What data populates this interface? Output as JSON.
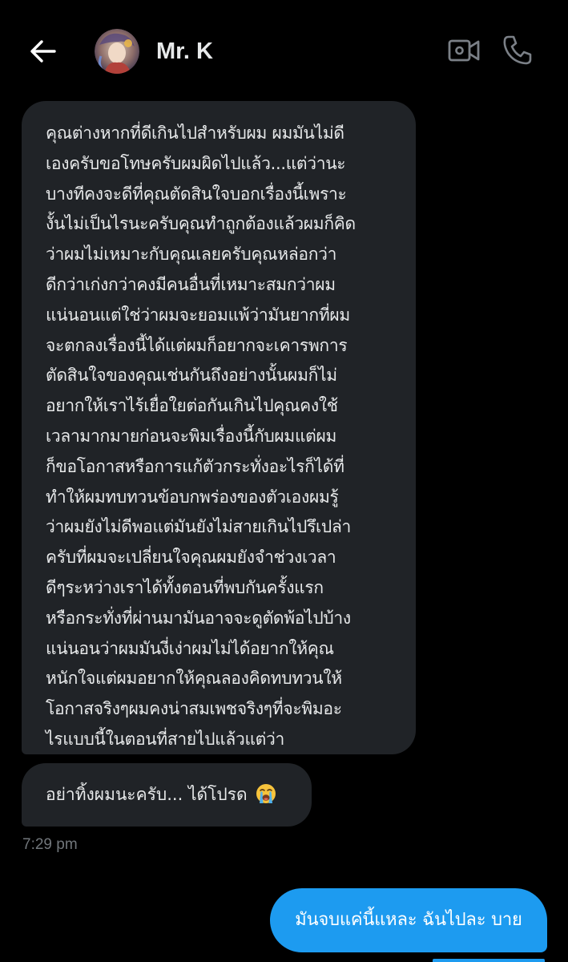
{
  "header": {
    "back_icon": "arrow-left-icon",
    "contact_name": "Mr. K",
    "video_icon": "video-camera-icon",
    "phone_icon": "phone-icon"
  },
  "messages": {
    "incoming_long_lines": [
      "คุณต่างหากที่ดีเกินไปสำหรับผม ผมมันไม่ดี",
      "เองครับขอโทษครับผมผิดไปแล้ว...แต่ว่านะ",
      "บางทีคงจะดีที่คุณตัดสินใจบอกเรื่องนี้เพราะ",
      "งั้นไม่เป็นไรนะครับคุณทำถูกต้องแล้วผมก็คิด",
      "ว่าผมไม่เหมาะกับคุณเลยครับคุณหล่อกว่า",
      "ดีกว่าเก่งกว่าคงมีคนอื่นที่เหมาะสมกว่าผม",
      "แน่นอนแต่ใช่ว่าผมจะยอมแพ้ว่ามันยากที่ผม",
      "จะตกลงเรื่องนี้ได้แต่ผมก็อยากจะเคารพการ",
      "ตัดสินใจของคุณเช่นกันถึงอย่างนั้นผมก็ไม่",
      "อยากให้เราไร้เยื่อใยต่อกันเกินไปคุณคงใช้",
      "เวลามากมายก่อนจะพิมเรื่องนี้กับผมแต่ผม",
      "ก็ขอโอกาสหรือการแก้ตัวกระทั่งอะไรก็ได้ที่",
      "ทำให้ผมทบทวนข้อบกพร่องของตัวเองผมรู้",
      "ว่าผมยังไม่ดีพอแต่มันยังไม่สายเกินไปรึเปล่า",
      "ครับที่ผมจะเปลี่ยนใจคุณผมยังจำช่วงเวลา",
      "ดีๆระหว่างเราได้ทั้งตอนที่พบกันครั้งแรก",
      "หรือกระทั่งที่ผ่านมามันอาจจะดูตัดพ้อไปบ้าง",
      "แน่นอนว่าผมมันงี่เง่าผมไม่ได้อยากให้คุณ",
      "หนักใจแต่ผมอยากให้คุณลองคิดทบทวนให้",
      "โอกาสจริงๆผมคงน่าสมเพชจริงๆที่จะพิมอะ",
      "ไรแบบนี้ในตอนที่สายไปแล้วแต่ว่า"
    ],
    "incoming_short": "อย่าทิ้งผมนะครับ... ได้โปรด",
    "incoming_short_emoji": "loudly-crying-face-icon",
    "timestamp": "7:29 pm",
    "outgoing": "มันจบแค่นี้แหละ ฉันไปละ บาย"
  },
  "colors": {
    "background": "#000000",
    "incoming_bubble": "#202327",
    "outgoing_bubble": "#1d9bf0",
    "primary_text": "#e7e9ea",
    "secondary_text": "#71767b"
  }
}
